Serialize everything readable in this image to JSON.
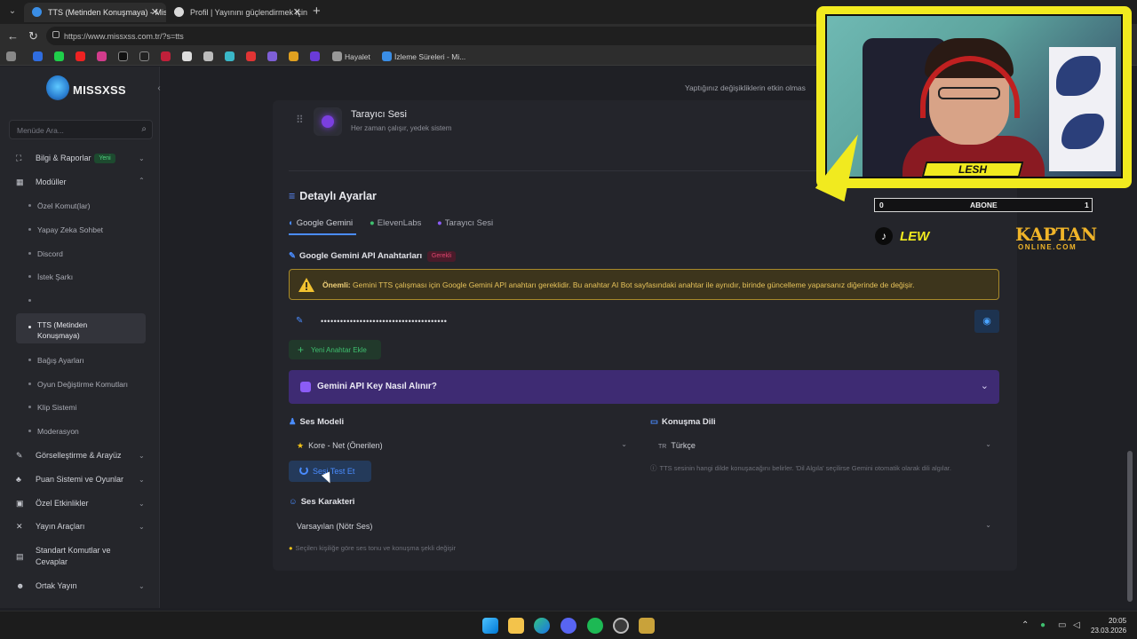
{
  "browser": {
    "tabs": [
      {
        "title": "TTS (Metinden Konuşmaya) - Miss",
        "active": true
      },
      {
        "title": "Profil | Yayınını güçlendirmek için",
        "active": false
      }
    ],
    "url": "https://www.missxss.com.tr/?s=tts",
    "bookmarks": [
      {
        "label": "Hayalet"
      },
      {
        "label": "İzleme Süreleri - Mi..."
      }
    ]
  },
  "app": {
    "logo": "MISSXSS",
    "notice": "Yaptığınız değişikliklerin etkin olmas"
  },
  "sidebar": {
    "search_placeholder": "Menüde Ara...",
    "items": {
      "bilgi": {
        "label": "Bilgi & Raporlar",
        "badge": "Yeni"
      },
      "moduller": {
        "label": "Modüller"
      },
      "gorsel": {
        "label": "Görselleştirme & Arayüz"
      },
      "puan": {
        "label": "Puan Sistemi ve Oyunlar"
      },
      "ozel": {
        "label": "Özel Etkinlikler"
      },
      "yayin": {
        "label": "Yayın Araçları"
      },
      "standart": {
        "label1": "Standart Komutlar ve",
        "label2": "Cevaplar"
      },
      "ortak": {
        "label": "Ortak Yayın"
      }
    },
    "sub": {
      "s1": "Özel Komut(lar)",
      "s2": "Yapay Zeka Sohbet",
      "s3": "Discord",
      "s4": "İstek Şarkı",
      "s5a": "TTS (Metinden",
      "s5b": "Konuşmaya)",
      "s6": "Bağış Ayarları",
      "s7": "Oyun Değiştirme Komutları",
      "s8": "Klip Sistemi",
      "s9": "Moderasyon"
    }
  },
  "main": {
    "browser_voice": {
      "title": "Tarayıcı Sesi",
      "subtitle": "Her zaman çalışır, yedek sistem"
    },
    "detailed_title": "Detaylı Ayarlar",
    "tabs": {
      "t1": "Google Gemini",
      "t2": "ElevenLabs",
      "t3": "Tarayıcı Sesi"
    },
    "api": {
      "title": "Google Gemini API Anahtarları",
      "badge": "Gerekli",
      "warning_bold": "Önemli:",
      "warning_text": "Gemini TTS çalışması için Google Gemini API anahtarı gereklidir. Bu anahtar AI Bot sayfasındaki anahtar ile aynıdır, birinde güncelleme yaparsanız diğerinde de değişir.",
      "key_value": "•••••••••••••••••••••••••••••••••••••••",
      "add_key": "Yeni Anahtar Ekle",
      "howto": "Gemini API Key Nasıl Alınır?"
    },
    "voice_model": {
      "label": "Ses Modeli",
      "value": "Kore - Net (Önerilen)",
      "test_button": "Sesi Test Et"
    },
    "language": {
      "label": "Konuşma Dili",
      "code": "TR",
      "value": "Türkçe",
      "hint": "TTS sesinin hangi dilde konuşacağını belirler. 'Dil Algıla' seçilirse Gemini otomatik olarak dili algılar."
    },
    "character": {
      "label": "Ses Karakteri",
      "value": "Varsayılan (Nötr Ses)",
      "hint": "Seçilen kişiliğe göre ses tonu ve konuşma şekli değişir"
    }
  },
  "overlay": {
    "streamer_name": "LESH",
    "sub_left": "0",
    "sub_center": "ABONE",
    "sub_right": "1",
    "tiktok_name": "LEW",
    "sponsor": "KAPTAN",
    "sponsor_sub": "ONLINE.COM"
  },
  "clock": {
    "time": "20:05",
    "date": "23.03.2026"
  }
}
